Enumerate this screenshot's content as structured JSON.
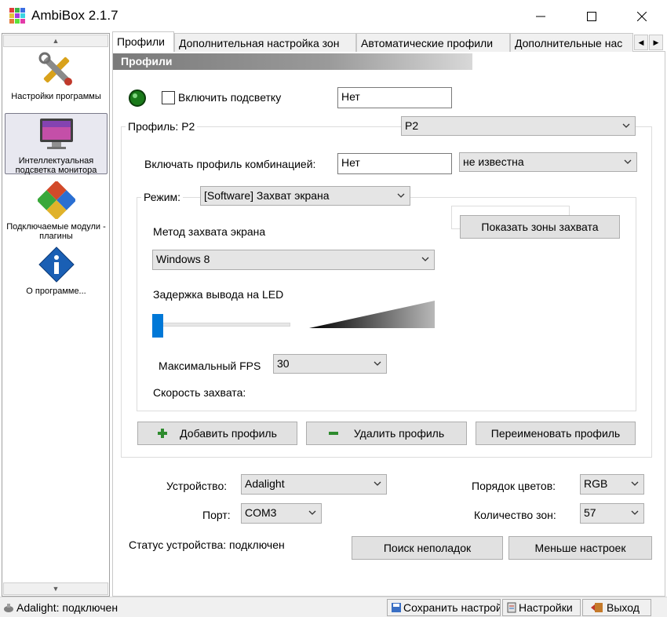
{
  "window": {
    "title": "AmbiBox 2.1.7"
  },
  "sidebar": {
    "items": [
      {
        "label": "Настройки программы",
        "icon": "tools-icon"
      },
      {
        "label": "Интеллектуальная подсветка монитора",
        "icon": "monitor-icon"
      },
      {
        "label": "Подключаемые модули - плагины",
        "icon": "puzzle-icon"
      },
      {
        "label": "О программе...",
        "icon": "info-icon"
      }
    ]
  },
  "tabs": [
    {
      "label": "Профили"
    },
    {
      "label": "Дополнительная настройка зон"
    },
    {
      "label": "Автоматические профили"
    },
    {
      "label": "Дополнительные нас"
    }
  ],
  "profiles": {
    "section_title": "Профили",
    "enable_backlight_label": "Включить подсветку",
    "enable_backlight_checked": false,
    "enable_hotkey_value": "Нет",
    "profile_label": "Профиль: P2",
    "profile_selected": "P2",
    "combo_label": "Включать профиль комбинацией:",
    "combo_value": "Нет",
    "combo_state": "не известна",
    "mode_label": "Режим:",
    "mode_selected": "[Software] Захват экрана",
    "show_zones_button": "Показать зоны захвата",
    "capture_method_label": "Метод захвата экрана",
    "capture_method_selected": "Windows 8",
    "led_delay_label": "Задержка вывода на LED",
    "led_delay_level": 0,
    "max_fps_label": "Максимальный FPS",
    "max_fps_selected": "30",
    "capture_speed_label": "Скорость захвата:",
    "add_profile_button": "Добавить профиль",
    "delete_profile_button": "Удалить профиль",
    "rename_profile_button": "Переименовать профиль"
  },
  "device": {
    "device_label": "Устройство:",
    "device_selected": "Adalight",
    "port_label": "Порт:",
    "port_selected": "COM3",
    "color_order_label": "Порядок цветов:",
    "color_order_selected": "RGB",
    "zones_label": "Количество зон:",
    "zones_selected": "57",
    "status_text": "Статус устройства: подключен",
    "troubleshoot_button": "Поиск неполадок",
    "less_settings_button": "Меньше настроек"
  },
  "statusbar": {
    "status_text": "Adalight: подключен",
    "save_button": "Сохранить настройки",
    "settings_button": "Настройки",
    "exit_button": "Выход"
  },
  "colors": {
    "accent": "#0078d7",
    "indicator_green": "#1a7a1a"
  }
}
